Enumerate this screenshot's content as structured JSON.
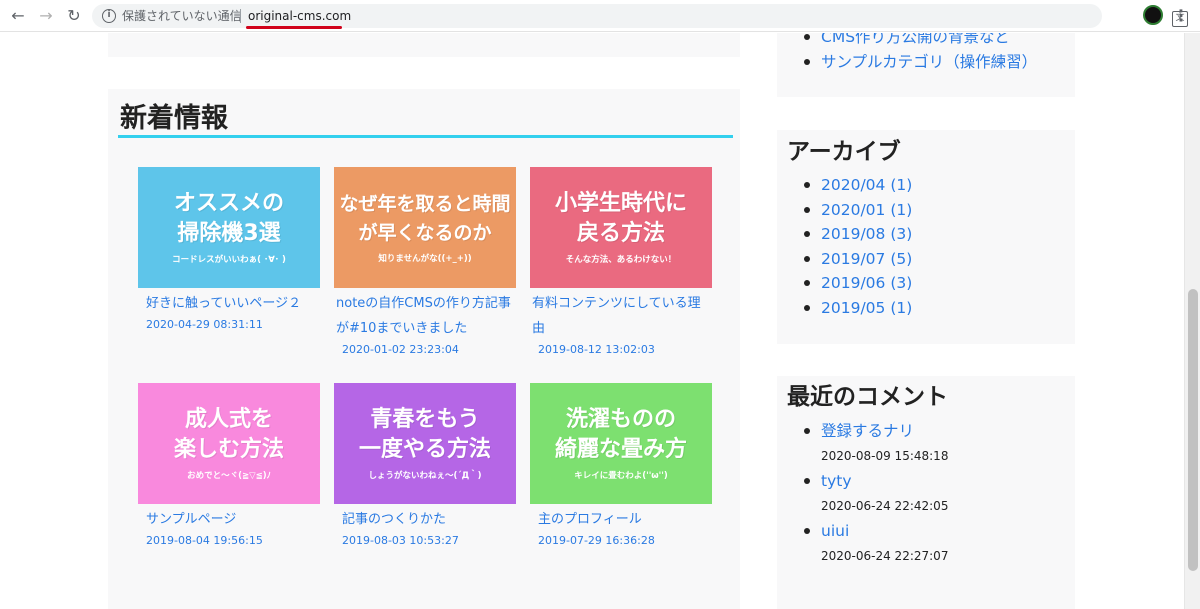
{
  "browser": {
    "security_text": "保護されていない通信",
    "url": "original-cms.com",
    "info_glyph": "i",
    "translate_glyph": "文"
  },
  "main": {
    "section_title": "新着情報",
    "cards": [
      {
        "thumb_title": "オススメの\n掃除機3選",
        "thumb_sub": "コードレスがいいわぁ( ･∀･ )",
        "title": "好きに触っていいページ２",
        "date": "2020-04-29 08:31:11",
        "bg": "#5ec5ea"
      },
      {
        "thumb_title": "なぜ年を取ると時間\nが早くなるのか",
        "thumb_sub": "知りませんがな((+_+))",
        "title": "noteの自作CMSの作り方記事が#10までいきました",
        "date": "2020-01-02 23:23:04",
        "bg": "#ec9a64"
      },
      {
        "thumb_title": "小学生時代に\n戻る方法",
        "thumb_sub": "そんな方法、あるわけない！",
        "title": "有料コンテンツにしている理由",
        "date": "2019-08-12 13:02:03",
        "bg": "#ea6a80"
      },
      {
        "thumb_title": "成人式を\n楽しむ方法",
        "thumb_sub": "おめでと～ヾ(≧▽≦)ﾉ",
        "title": "サンプルページ",
        "date": "2019-08-04 19:56:15",
        "bg": "#f989dd"
      },
      {
        "thumb_title": "青春をもう\n一度やる方法",
        "thumb_sub": "しょうがないわねぇ～(´Д｀)",
        "title": "記事のつくりかた",
        "date": "2019-08-03 10:53:27",
        "bg": "#b566e6"
      },
      {
        "thumb_title": "洗濯ものの\n綺麗な畳み方",
        "thumb_sub": "キレイに畳むわよ(''ω'')",
        "title": "主のプロフィール",
        "date": "2019-07-29 16:36:28",
        "bg": "#7de070"
      }
    ]
  },
  "sidebar": {
    "categories": [
      "CMS作り方公開の背景など",
      "サンプルカテゴリ（操作練習）"
    ],
    "archive_title": "アーカイブ",
    "archives": [
      "2020/04 (1)",
      "2020/01 (1)",
      "2019/08 (3)",
      "2019/07 (5)",
      "2019/06 (3)",
      "2019/05 (1)"
    ],
    "comments_title": "最近のコメント",
    "comments": [
      {
        "name": "登録するナリ",
        "date": "2020-08-09 15:48:18"
      },
      {
        "name": "tyty",
        "date": "2020-06-24 22:42:05"
      },
      {
        "name": "uiui",
        "date": "2020-06-24 22:27:07"
      }
    ]
  }
}
